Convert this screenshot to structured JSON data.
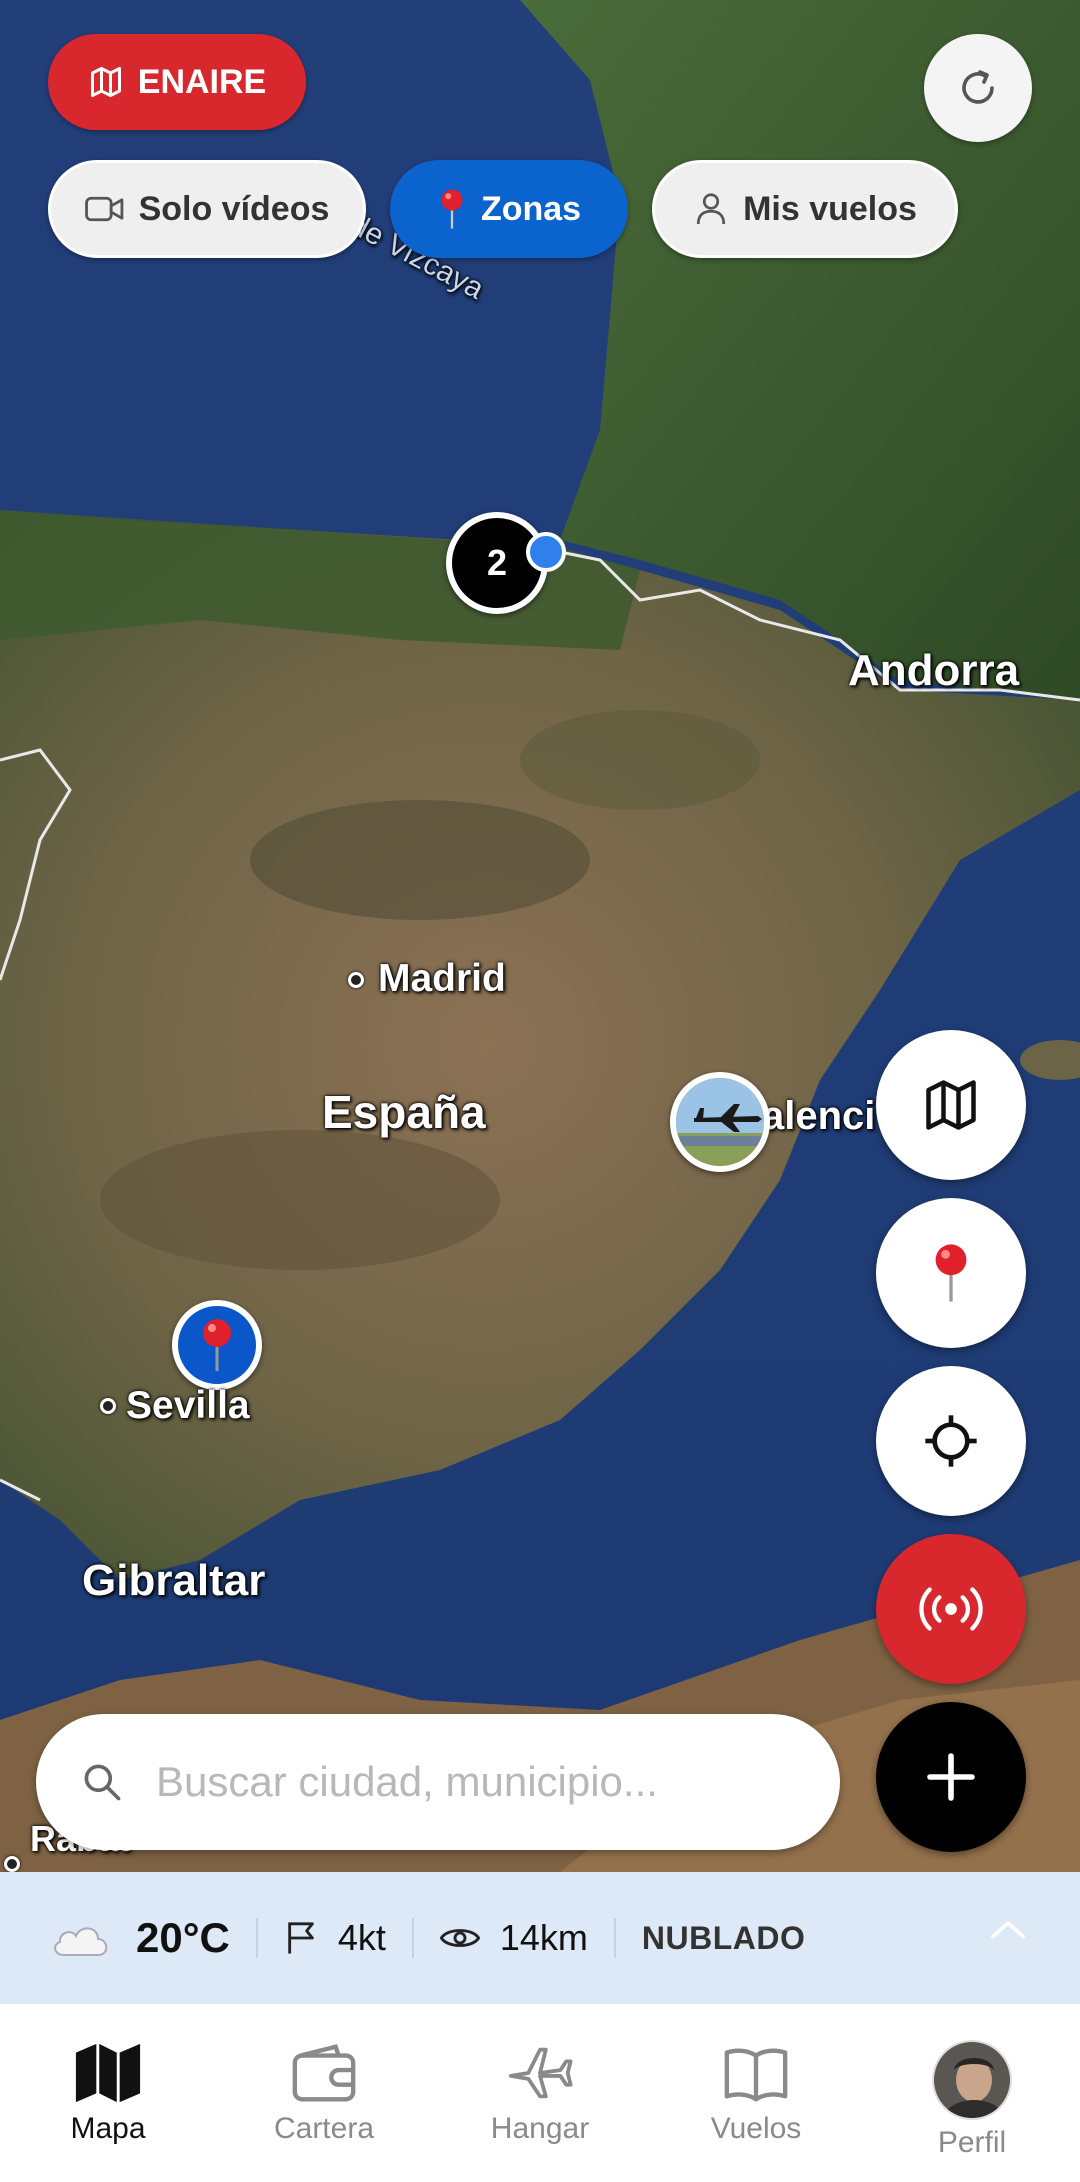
{
  "header": {
    "enaire_label": "ENAIRE",
    "filters": [
      {
        "label": "Solo vídeos",
        "active": false
      },
      {
        "label": "Zonas",
        "active": true
      },
      {
        "label": "Mis vuelos",
        "active": false
      }
    ]
  },
  "map": {
    "labels": {
      "andorra": "Andorra",
      "madrid": "Madrid",
      "espana": "España",
      "valencia": "alenci",
      "sevilla": "Sevilla",
      "gibraltar": "Gibraltar",
      "rabat": "Rabat",
      "vizcaya": "de Vizcaya"
    },
    "cluster_count": "2"
  },
  "search": {
    "placeholder": "Buscar ciudad, municipio..."
  },
  "weather": {
    "temperature": "20°C",
    "wind": "4kt",
    "visibility": "14km",
    "condition": "NUBLADO"
  },
  "nav": {
    "items": [
      {
        "label": "Mapa",
        "active": true
      },
      {
        "label": "Cartera",
        "active": false
      },
      {
        "label": "Hangar",
        "active": false
      },
      {
        "label": "Vuelos",
        "active": false
      },
      {
        "label": "Perfil",
        "active": false
      }
    ]
  },
  "colors": {
    "accent_red": "#d9272e",
    "accent_blue": "#0b63ce",
    "weather_bg": "#dde9f6"
  }
}
